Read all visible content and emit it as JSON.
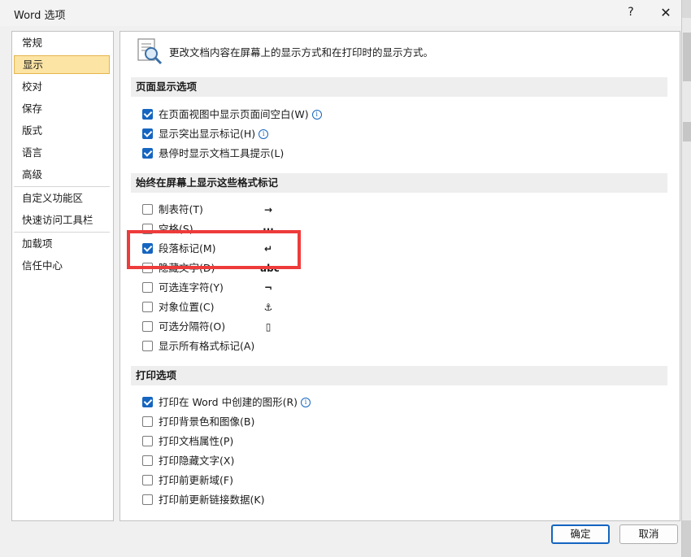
{
  "window": {
    "title": "Word 选项",
    "help_label": "?",
    "close_label": "✕"
  },
  "sidebar": {
    "items": [
      {
        "label": "常规"
      },
      {
        "label": "显示"
      },
      {
        "label": "校对"
      },
      {
        "label": "保存"
      },
      {
        "label": "版式"
      },
      {
        "label": "语言"
      },
      {
        "label": "高级"
      },
      {
        "label": "自定义功能区"
      },
      {
        "label": "快速访问工具栏"
      },
      {
        "label": "加载项"
      },
      {
        "label": "信任中心"
      }
    ],
    "selected": "显示"
  },
  "content": {
    "header_text": "更改文档内容在屏幕上的显示方式和在打印时的显示方式。",
    "sections": [
      {
        "title": "页面显示选项",
        "options": [
          {
            "label": "在页面视图中显示页面间空白(W)",
            "checked": true,
            "info": true
          },
          {
            "label": "显示突出显示标记(H)",
            "checked": true,
            "info": true
          },
          {
            "label": "悬停时显示文档工具提示(L)",
            "checked": true,
            "info": false
          }
        ]
      },
      {
        "title": "始终在屏幕上显示这些格式标记",
        "options": [
          {
            "label": "制表符(T)",
            "checked": false,
            "symbol": "→"
          },
          {
            "label": "空格(S)",
            "checked": false,
            "symbol": "···"
          },
          {
            "label": "段落标记(M)",
            "checked": true,
            "symbol": "↵"
          },
          {
            "label": "隐藏文字(D)",
            "checked": false,
            "symbol": "abc"
          },
          {
            "label": "可选连字符(Y)",
            "checked": false,
            "symbol": "¬"
          },
          {
            "label": "对象位置(C)",
            "checked": false,
            "symbol": "⚓"
          },
          {
            "label": "可选分隔符(O)",
            "checked": false,
            "symbol": "▯"
          },
          {
            "label": "显示所有格式标记(A)",
            "checked": false
          }
        ]
      },
      {
        "title": "打印选项",
        "options": [
          {
            "label": "打印在 Word 中创建的图形(R)",
            "checked": true,
            "info": true
          },
          {
            "label": "打印背景色和图像(B)",
            "checked": false
          },
          {
            "label": "打印文档属性(P)",
            "checked": false
          },
          {
            "label": "打印隐藏文字(X)",
            "checked": false
          },
          {
            "label": "打印前更新域(F)",
            "checked": false
          },
          {
            "label": "打印前更新链接数据(K)",
            "checked": false
          }
        ]
      }
    ],
    "info_glyph": "i"
  },
  "footer": {
    "ok_label": "确定",
    "cancel_label": "取消"
  },
  "colors": {
    "accent": "#1565c0",
    "selection": "#fce4a4",
    "highlight_box": "#ee3b3b"
  }
}
